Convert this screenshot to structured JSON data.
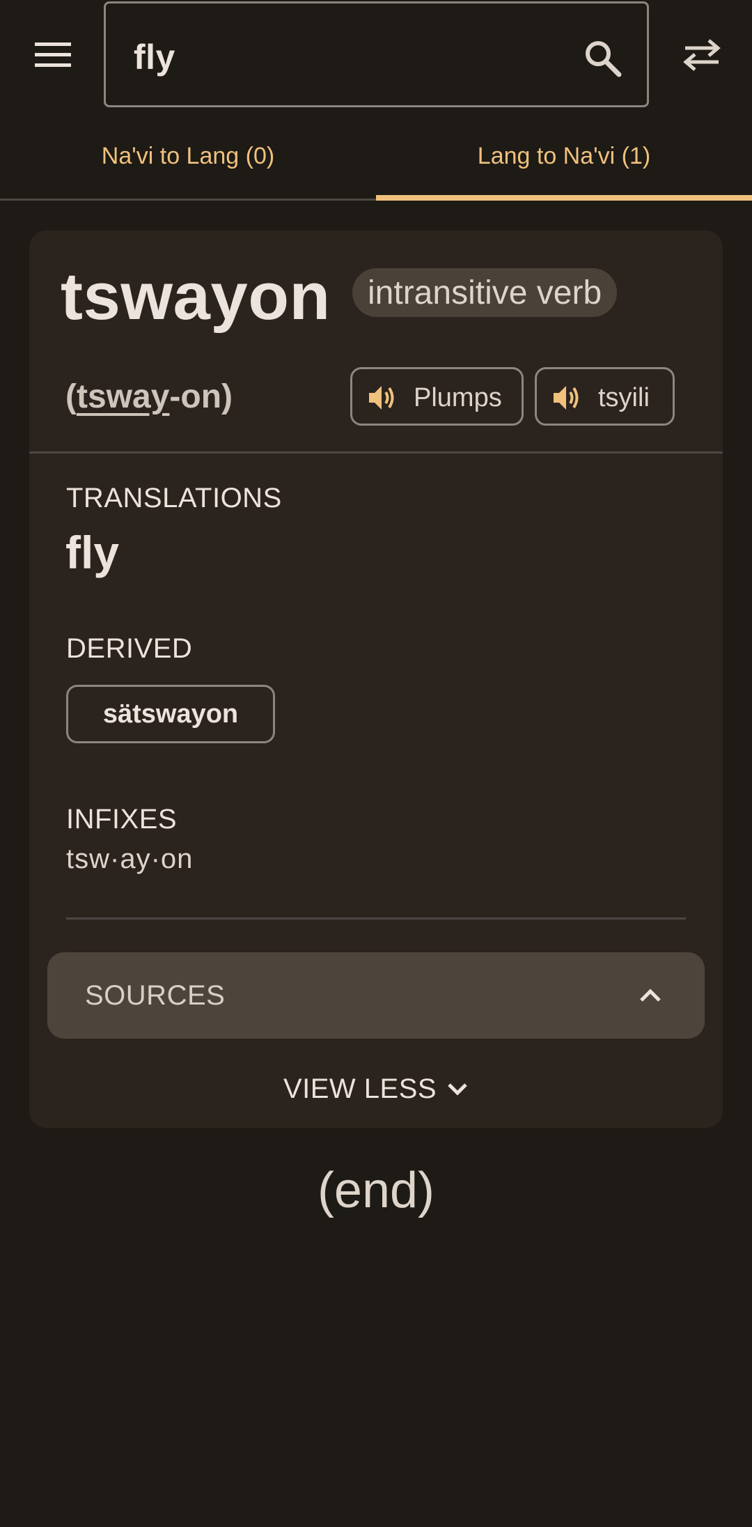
{
  "search": {
    "query": "fly"
  },
  "tabs": [
    {
      "label": "Na'vi to Lang (0)",
      "active": false
    },
    {
      "label": "Lang to Na'vi (1)",
      "active": true
    }
  ],
  "entry": {
    "word": "tswayon",
    "part_of_speech": "intransitive verb",
    "pronunciation": {
      "open": "(",
      "stressed": "tsway",
      "rest": "-on",
      "close": ")"
    },
    "audio": [
      {
        "label": "Plumps",
        "icon": "speaker-icon"
      },
      {
        "label": "tsyili",
        "icon": "speaker-icon"
      }
    ],
    "translations_title": "TRANSLATIONS",
    "translation": "fly",
    "derived_title": "DERIVED",
    "derived": [
      "sätswayon"
    ],
    "infixes_title": "INFIXES",
    "infixes": "tsw·ay·on",
    "sources_label": "SOURCES",
    "view_less_label": "VIEW LESS"
  },
  "end_text": "(end)",
  "colors": {
    "background": "#1e1a16",
    "card": "#2b231d",
    "accent": "#efc17d",
    "text": "#ece4dc",
    "sources_bg": "#4d443b"
  }
}
